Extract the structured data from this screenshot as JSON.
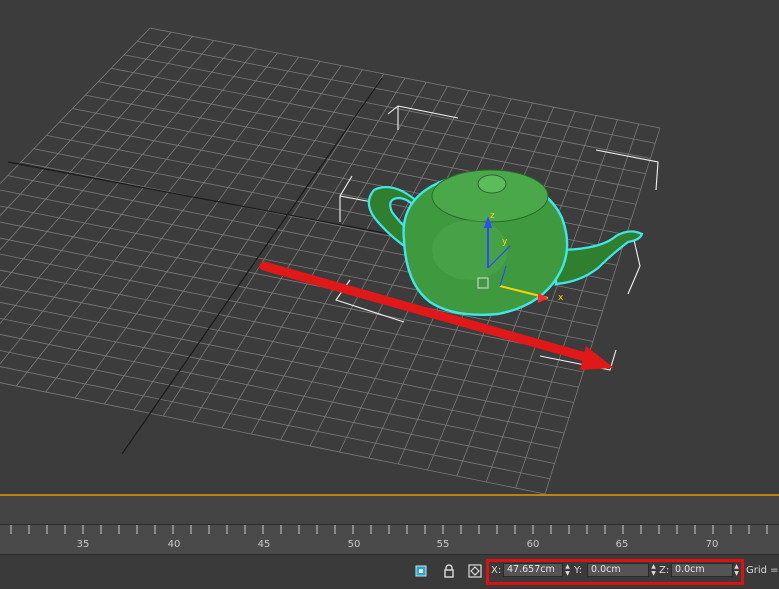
{
  "viewport": {
    "grid_color": "#7a7a7a",
    "axis_color": "#1a1a1a",
    "teapot_color": "#3f9a3f",
    "selection_color": "#3ee8e8",
    "arrow_color": "#e01818"
  },
  "gizmo": {
    "x_label": "x",
    "y_label": "y",
    "z_label": "z"
  },
  "timeline": {
    "labels": [
      "35",
      "40",
      "45",
      "50",
      "55",
      "60",
      "65",
      "70"
    ]
  },
  "statusbar": {
    "x_label": "X:",
    "x_value": "47.657cm",
    "y_label": "Y:",
    "y_value": "0.0cm",
    "z_label": "Z:",
    "z_value": "0.0cm",
    "grid_label": "Grid ="
  }
}
